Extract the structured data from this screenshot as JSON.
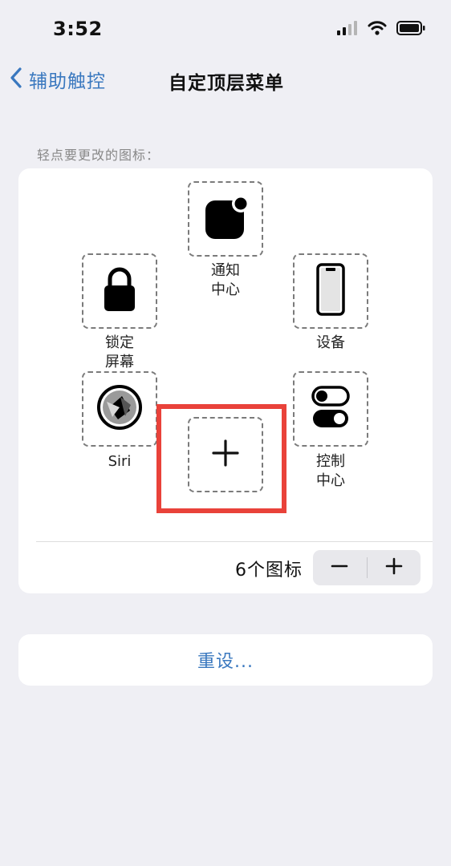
{
  "status_bar": {
    "time": "3:52"
  },
  "nav": {
    "back_label": "辅助触控",
    "title": "自定顶层菜单"
  },
  "section_hint": "轻点要更改的图标：",
  "menu_items": {
    "notification_center": "通知\n中心",
    "lock_screen": "锁定\n屏幕",
    "device": "设备",
    "siri": "Siri",
    "control_center": "控制\n中心"
  },
  "add_slot": {
    "symbol": "+",
    "highlighted": true,
    "highlight_color": "#e9423a"
  },
  "icon_count_label": "6个图标",
  "stepper": {
    "minus": "−",
    "plus": "+"
  },
  "reset_label": "重设...",
  "colors": {
    "accent": "#3a78bf",
    "background": "#efeff4",
    "highlight": "#e9423a"
  }
}
